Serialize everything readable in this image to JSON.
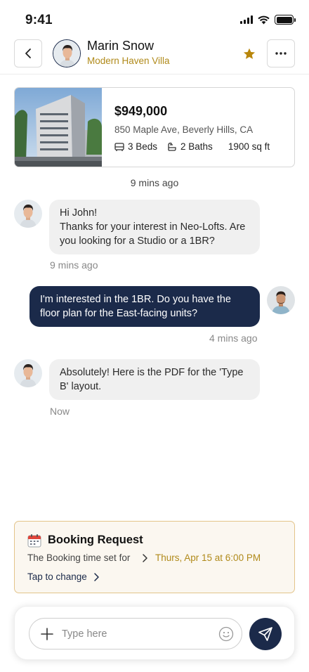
{
  "status_bar": {
    "time": "9:41"
  },
  "header": {
    "contact_name": "Marin Snow",
    "property_name": "Modern Haven Villa"
  },
  "listing": {
    "price": "$949,000",
    "address": "850 Maple Ave, Beverly Hills, CA",
    "beds": "3 Beds",
    "baths": "2 Baths",
    "area": "1900 sq ft"
  },
  "chat": {
    "top_timestamp": "9 mins ago",
    "messages": [
      {
        "sender": "agent",
        "lines": [
          "Hi John!",
          "Thanks for your interest in Neo-Lofts. Are you looking for a Studio or a 1BR?"
        ],
        "time": "9 mins ago"
      },
      {
        "sender": "user",
        "text": "I'm interested in the 1BR. Do you have the floor plan for the East-facing units?",
        "time": "4 mins ago"
      },
      {
        "sender": "agent",
        "text": "Absolutely! Here is the PDF for the 'Type B' layout.",
        "time": "Now"
      }
    ]
  },
  "booking": {
    "title": "Booking Request",
    "label": "The Booking time set for",
    "value": "Thurs, Apr 15 at 6:00 PM",
    "action": "Tap to change"
  },
  "composer": {
    "placeholder": "Type here"
  },
  "colors": {
    "navy": "#1b2a4a",
    "gold": "#b08a1a",
    "bubble_gray": "#f0f0f0"
  }
}
